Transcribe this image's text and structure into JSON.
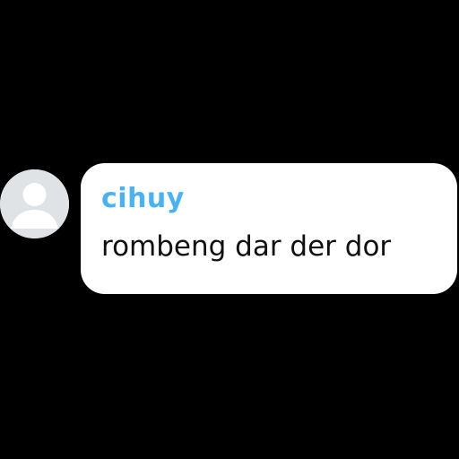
{
  "comment": {
    "avatar_icon": "user-placeholder-icon",
    "username": "cihuy",
    "message": "rombeng dar der dor"
  },
  "colors": {
    "background": "#000000",
    "bubble": "#ffffff",
    "username": "#4ab3ef",
    "message": "#111111",
    "avatar_bg": "#dfe3e6",
    "avatar_fg": "#ffffff"
  }
}
